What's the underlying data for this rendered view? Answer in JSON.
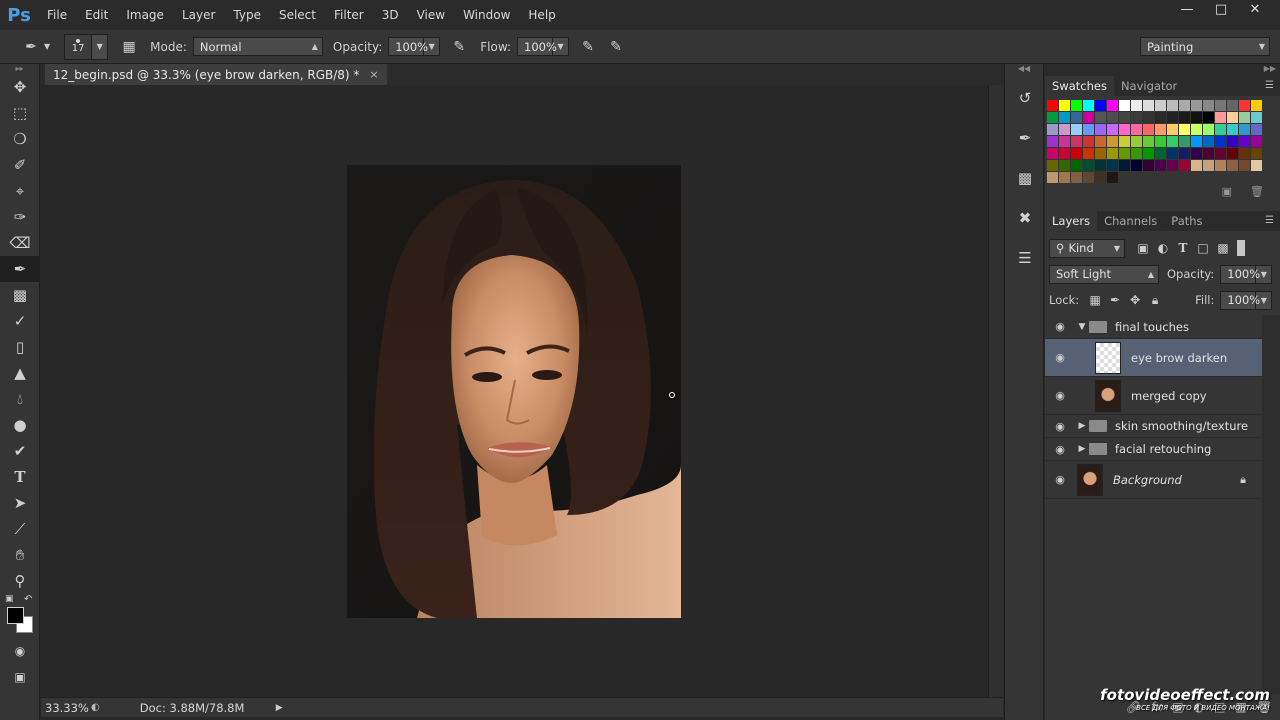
{
  "app": {
    "logo": "Ps"
  },
  "menu": [
    "File",
    "Edit",
    "Image",
    "Layer",
    "Type",
    "Select",
    "Filter",
    "3D",
    "View",
    "Window",
    "Help"
  ],
  "options": {
    "brush_size": "17",
    "mode_label": "Mode:",
    "mode_value": "Normal",
    "opacity_label": "Opacity:",
    "opacity_value": "100%",
    "flow_label": "Flow:",
    "flow_value": "100%",
    "workspace": "Painting"
  },
  "document": {
    "tab_title": "12_begin.psd @ 33.3% (eye brow darken, RGB/8) *",
    "close": "×"
  },
  "status": {
    "zoom": "33.33%",
    "doc_info": "Doc: 3.88M/78.8M"
  },
  "swatches_panel": {
    "tabs": [
      "Swatches",
      "Navigator"
    ],
    "colors": [
      "#ff0000",
      "#ffff00",
      "#00ff00",
      "#00ffff",
      "#0000ff",
      "#ff00ff",
      "#ffffff",
      "#eeeeee",
      "#dddddd",
      "#cccccc",
      "#bbbbbb",
      "#aaaaaa",
      "#999999",
      "#888888",
      "#777777",
      "#666666",
      "#ff3333",
      "#ffcc00",
      "#009944",
      "#0099cc",
      "#336699",
      "#cc0099",
      "#555555",
      "#4d4d4d",
      "#444444",
      "#3b3b3b",
      "#333333",
      "#2a2a2a",
      "#222222",
      "#1a1a1a",
      "#111111",
      "#000000",
      "#ff9999",
      "#ffcc99",
      "#99cc99",
      "#66cccc",
      "#9999cc",
      "#cc99cc",
      "#99ccff",
      "#6699ff",
      "#9966ff",
      "#cc66ff",
      "#ff66cc",
      "#ff6699",
      "#ff6666",
      "#ff9966",
      "#ffcc66",
      "#ffff66",
      "#ccff66",
      "#99ff66",
      "#33cc99",
      "#33cccc",
      "#3399cc",
      "#6666cc",
      "#9933cc",
      "#cc3399",
      "#cc3366",
      "#cc3333",
      "#cc6633",
      "#cc9933",
      "#cccc33",
      "#99cc33",
      "#66cc33",
      "#33cc33",
      "#33cc66",
      "#339966",
      "#0099ff",
      "#0066cc",
      "#0033cc",
      "#3300cc",
      "#6600cc",
      "#990099",
      "#cc0066",
      "#cc0033",
      "#cc0000",
      "#cc3300",
      "#996600",
      "#999900",
      "#669900",
      "#339900",
      "#009900",
      "#006633",
      "#003366",
      "#1a1a66",
      "#33004d",
      "#4d0033",
      "#660033",
      "#660000",
      "#663300",
      "#664400",
      "#666600",
      "#336600",
      "#006600",
      "#004d33",
      "#003333",
      "#00334d",
      "#001a33",
      "#000033",
      "#330033",
      "#4d004d",
      "#66004d",
      "#990033",
      "#d9b38c",
      "#c8a07a",
      "#b08060",
      "#8c6040",
      "#704830",
      "#e0c8a0",
      "#c09870",
      "#a07850",
      "#806040",
      "#604830",
      "#403020",
      "#201810"
    ]
  },
  "layers_panel": {
    "tabs": [
      "Layers",
      "Channels",
      "Paths"
    ],
    "filter_kind": "Kind",
    "blend_mode": "Soft Light",
    "opacity_label": "Opacity:",
    "opacity_value": "100%",
    "lock_label": "Lock:",
    "fill_label": "Fill:",
    "fill_value": "100%",
    "layers": [
      {
        "name": "final touches",
        "type": "group",
        "expanded": true
      },
      {
        "name": "eye brow darken",
        "type": "layer",
        "selected": true
      },
      {
        "name": "merged copy",
        "type": "layer"
      },
      {
        "name": "skin smoothing/texture",
        "type": "group",
        "expanded": false
      },
      {
        "name": "facial retouching",
        "type": "group",
        "expanded": false
      },
      {
        "name": "Background",
        "type": "background",
        "locked": true
      }
    ]
  },
  "watermark": {
    "main": "fotovideoeffect.com",
    "sub": "ВСЕ ДЛЯ ФОТО И ВИДЕО МОНТАЖА!"
  }
}
